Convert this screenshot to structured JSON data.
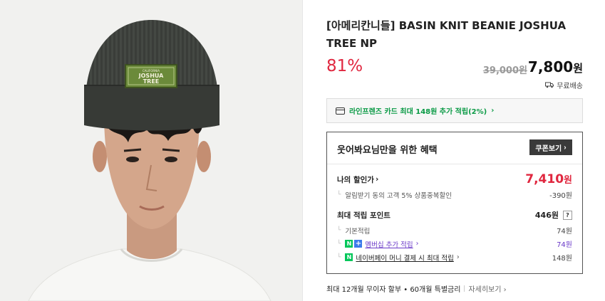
{
  "product": {
    "title": "[아메리칸니들] BASIN KNIT BEANIE JOSHUA TREE NP",
    "discount_rate": "81%",
    "original_price": "39,000원",
    "sale_price": "7,800",
    "sale_price_unit": "원",
    "shipping": "무료배송",
    "image_alt": "BASIN KNIT BEANIE JOSHUA TREE",
    "patch_small": "CALIFORNIA",
    "patch_line1": "JOSHUA",
    "patch_line2": "TREE"
  },
  "card_promo": {
    "text": "라인프렌즈 카드 최대 148원 추가 적립(2%)",
    "icon": "credit-card-icon"
  },
  "benefits": {
    "heading": "웃어봐요님만을 위한 혜택",
    "coupon_button": "쿠폰보기",
    "my_discount_label": "나의 할인가",
    "my_price": "7,410",
    "my_price_unit": "원",
    "discount_detail": "알림받기 동의 고객 5% 상품중복할인",
    "discount_amount": "-390원",
    "points_label": "최대 적립 포인트",
    "points_total": "446원",
    "points_help": "?",
    "basic_label": "기본적립",
    "basic_value": "74원",
    "membership_label": "멤버십 추가 적립",
    "membership_value": "74원",
    "npay_label": "네이버페이 머니 결제 시 최대 적립",
    "npay_value": "148원"
  },
  "installment": {
    "text": "최대 12개월 무이자 할부 • 60개월 특별금리",
    "more": "자세히보기"
  },
  "colors": {
    "accent_red": "#e0273f",
    "promo_green": "#0a9a45",
    "naver_green": "#03c75a",
    "membership_purple": "#6a39c8"
  }
}
